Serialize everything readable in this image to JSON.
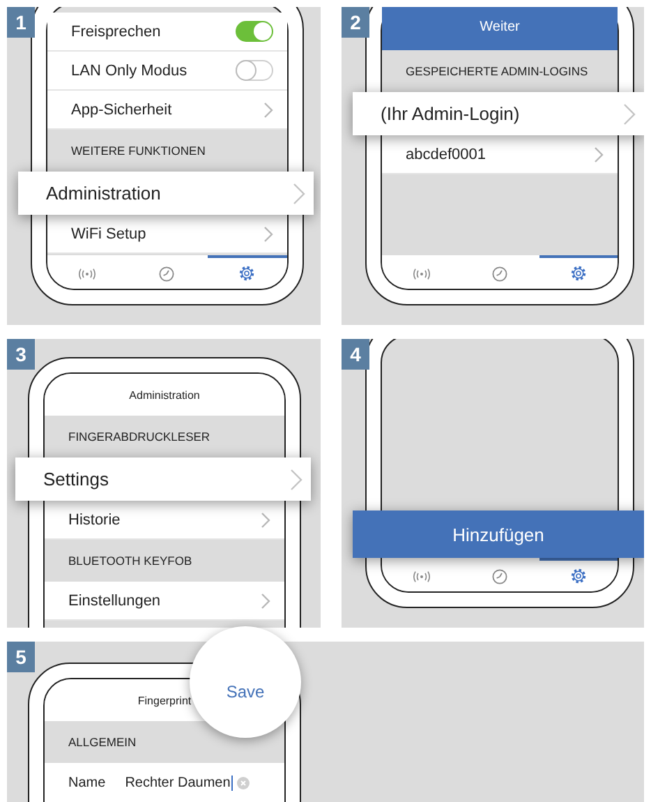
{
  "steps": [
    {
      "number": "1",
      "rows": [
        {
          "kind": "toggle",
          "label": "Freisprechen",
          "on": true
        },
        {
          "kind": "toggle",
          "label": "LAN Only Modus",
          "on": false
        },
        {
          "kind": "link",
          "label": "App-Sicherheit"
        },
        {
          "kind": "header",
          "label": "WEITERE FUNKTIONEN"
        },
        {
          "kind": "callout_link",
          "label": "Administration"
        },
        {
          "kind": "link",
          "label": "WiFi Setup"
        }
      ],
      "tabs": [
        {
          "selected": false
        },
        {
          "selected": false
        },
        {
          "selected": true
        }
      ]
    },
    {
      "number": "2",
      "rows": [
        {
          "kind": "bar",
          "label": "Weiter"
        },
        {
          "kind": "header",
          "label": "GESPEICHERTE ADMIN-LOGINS"
        },
        {
          "kind": "callout_link",
          "label": "(Ihr Admin-Login)"
        },
        {
          "kind": "link",
          "label": "abcdef0001"
        }
      ],
      "tabs": [
        {
          "selected": false
        },
        {
          "selected": false
        },
        {
          "selected": true
        }
      ]
    },
    {
      "number": "3",
      "rows": [
        {
          "kind": "title",
          "label": "Administration"
        },
        {
          "kind": "header",
          "label": "FINGERABDRUCKLESER"
        },
        {
          "kind": "callout_link",
          "label": "Settings"
        },
        {
          "kind": "link",
          "label": "Historie"
        },
        {
          "kind": "header",
          "label": "BLUETOOTH KEYFOB"
        },
        {
          "kind": "link",
          "label": "Einstellungen"
        }
      ]
    },
    {
      "number": "4",
      "rows": [
        {
          "kind": "callout_button",
          "label": "Hinzufügen"
        }
      ],
      "tabs": [
        {
          "selected": false
        },
        {
          "selected": false
        },
        {
          "selected": true
        }
      ]
    },
    {
      "number": "5",
      "rows": [
        {
          "kind": "title",
          "label": "Fingerprint",
          "action": "Save",
          "magnified": true
        },
        {
          "kind": "header",
          "label": "ALLGEMEIN"
        },
        {
          "kind": "field",
          "label": "Name",
          "value": "Rechter Daumen",
          "focused": true
        }
      ]
    }
  ]
}
